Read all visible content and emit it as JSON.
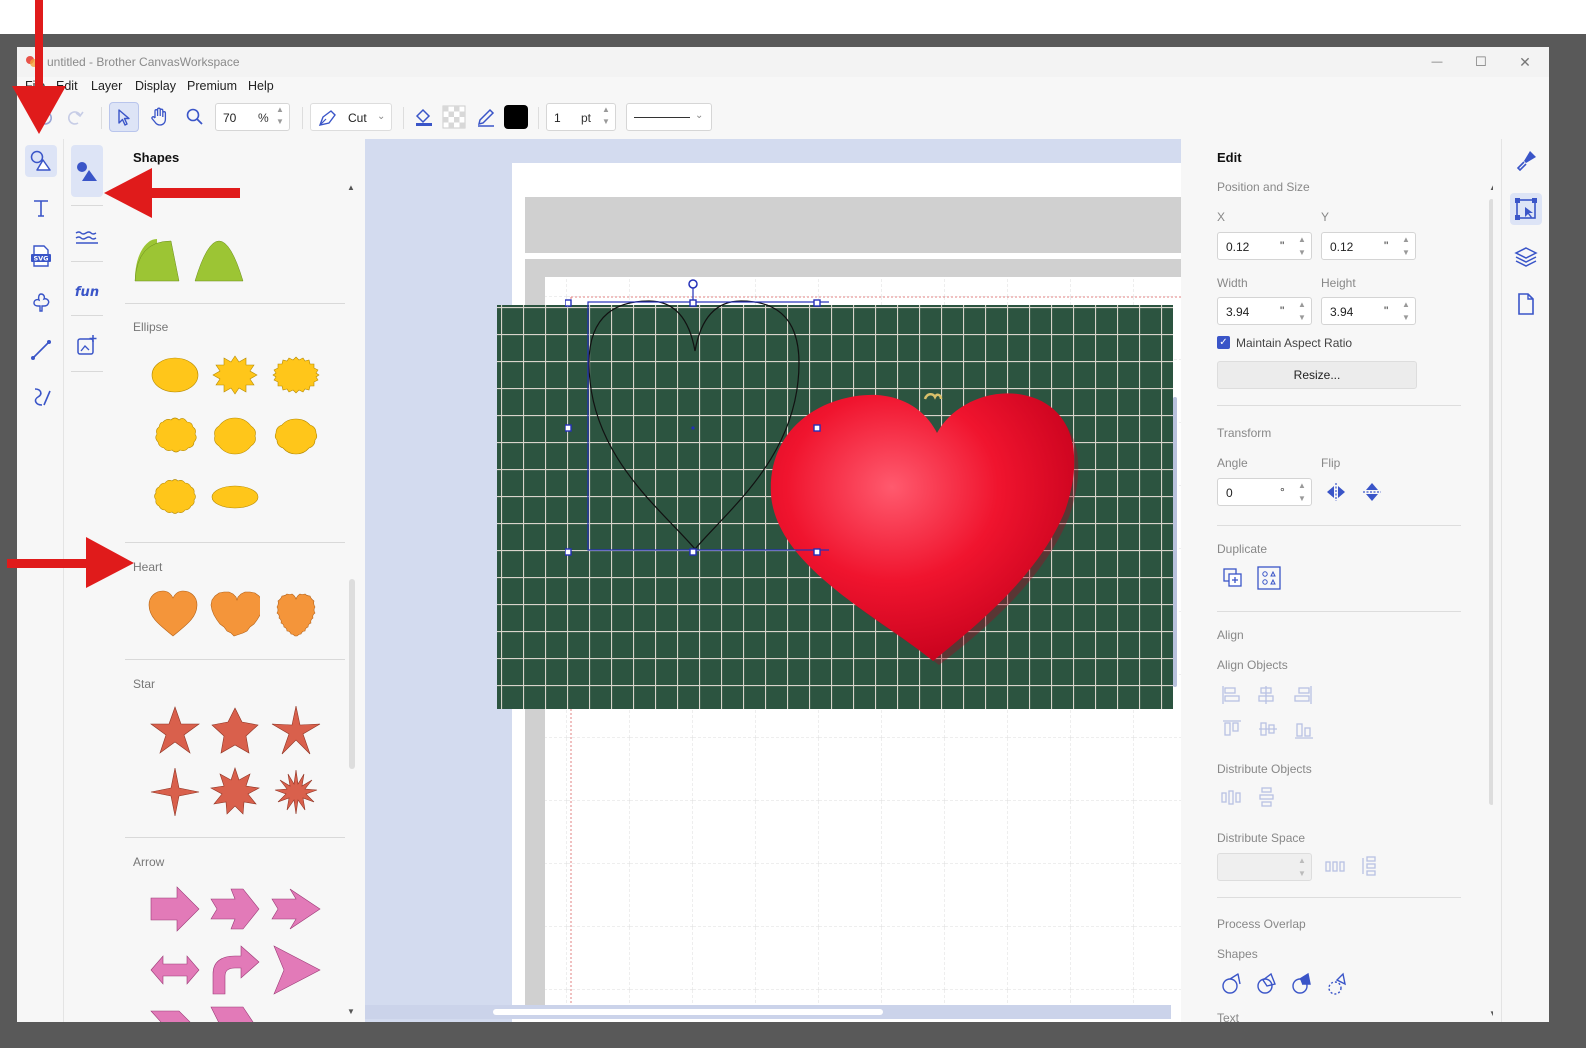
{
  "window": {
    "title": "untitled - Brother CanvasWorkspace",
    "minimize_glyph": "—",
    "maximize_glyph": "☐",
    "close_glyph": "✕"
  },
  "menu": [
    "File",
    "Edit",
    "Layer",
    "Display",
    "Premium",
    "Help"
  ],
  "toolbar": {
    "zoom_value": "70",
    "zoom_unit": "%",
    "mode_label": "Cut",
    "line_width_value": "1",
    "line_width_unit": "pt",
    "stroke_color": "#000000"
  },
  "shapes_panel": {
    "title": "Shapes",
    "sections": [
      {
        "title": "Ellipse"
      },
      {
        "title": "Heart"
      },
      {
        "title": "Star"
      },
      {
        "title": "Arrow"
      }
    ],
    "colors": {
      "semicircle": "#9cc534",
      "ellipse": "#ffc61a",
      "heart": "#f4953a",
      "star": "#d9604c",
      "arrow": "#e27ab8"
    }
  },
  "edit_panel": {
    "title": "Edit",
    "position_and_size": "Position and Size",
    "x_label": "X",
    "x_value": "0.12",
    "y_label": "Y",
    "y_value": "0.12",
    "width_label": "Width",
    "width_value": "3.94",
    "height_label": "Height",
    "height_value": "3.94",
    "unit": "\"",
    "maintain_aspect_ratio": "Maintain Aspect Ratio",
    "maintain_aspect_checked": true,
    "resize_button": "Resize...",
    "transform": "Transform",
    "angle_label": "Angle",
    "angle_value": "0",
    "angle_unit": "°",
    "flip_label": "Flip",
    "duplicate": "Duplicate",
    "align": "Align",
    "align_objects": "Align Objects",
    "distribute_objects": "Distribute Objects",
    "distribute_space": "Distribute Space",
    "process_overlap": "Process Overlap",
    "shapes_label": "Shapes",
    "text_label": "Text"
  },
  "colors": {
    "accent": "#3a55c8",
    "annotation_arrow": "#e01b1b",
    "canvas_bg": "#d3dbef",
    "photo_grid_bg": "#2f5a45",
    "red_heart": "#f0142e"
  }
}
